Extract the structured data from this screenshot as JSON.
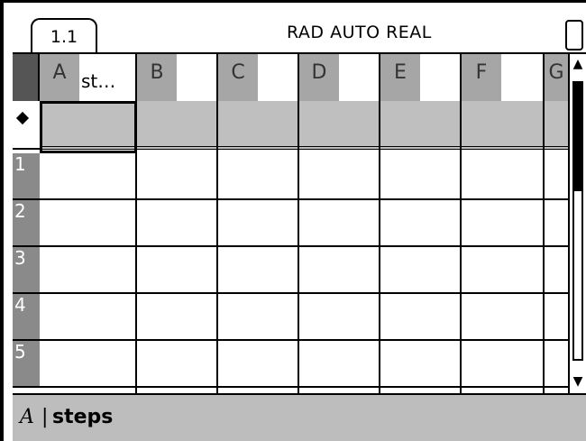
{
  "statusbar": {
    "tab_label": "1.1",
    "mode_text": "RAD AUTO REAL"
  },
  "sheet": {
    "columns": [
      {
        "letter": "A",
        "name": "st…"
      },
      {
        "letter": "B",
        "name": ""
      },
      {
        "letter": "C",
        "name": ""
      },
      {
        "letter": "D",
        "name": ""
      },
      {
        "letter": "E",
        "name": ""
      },
      {
        "letter": "F",
        "name": ""
      },
      {
        "letter": "G",
        "name": ""
      }
    ],
    "rows": [
      "1",
      "2",
      "3",
      "4",
      "5"
    ]
  },
  "entry_line": {
    "cell_ref": "A",
    "separator": "|",
    "value": "steps"
  },
  "colors": {
    "header_gray": "#a6a6a6",
    "formula_row": "#bfbfbf",
    "entry_bg": "#bdbdbd"
  }
}
